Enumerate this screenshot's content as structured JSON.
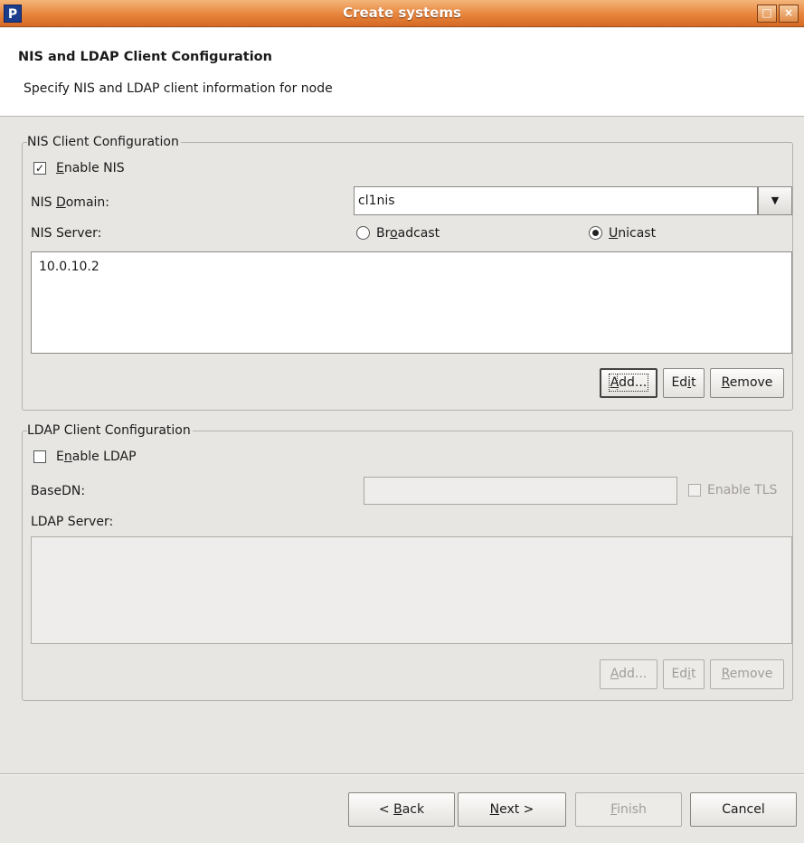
{
  "window": {
    "icon_letter": "P",
    "title": "Create systems",
    "maximize_glyph": "□",
    "close_glyph": "×"
  },
  "header": {
    "title": "NIS and LDAP Client Configuration",
    "description": "Specify NIS and LDAP client information for node"
  },
  "nis": {
    "group_label": "NIS Client Configuration",
    "enable_label_pre": "",
    "enable_label_mnemonic": "E",
    "enable_label_post": "nable NIS",
    "enable_checked": true,
    "domain_label_pre": "NIS ",
    "domain_label_mnemonic": "D",
    "domain_label_post": "omain:",
    "domain_value": "cl1nis",
    "server_label": "NIS Server:",
    "broadcast_pre": "Br",
    "broadcast_mnemonic": "o",
    "broadcast_post": "adcast",
    "unicast_pre": "",
    "unicast_mnemonic": "U",
    "unicast_post": "nicast",
    "selected_mode": "Unicast",
    "servers": [
      "10.0.10.2"
    ],
    "add_mnemonic": "A",
    "add_post": "dd...",
    "edit_pre": "Ed",
    "edit_mnemonic": "i",
    "edit_post": "t",
    "remove_mnemonic": "R",
    "remove_post": "emove"
  },
  "ldap": {
    "group_label": "LDAP Client Configuration",
    "enable_pre": "E",
    "enable_mnemonic": "n",
    "enable_post": "able LDAP",
    "enable_checked": false,
    "basedn_label": "BaseDN:",
    "basedn_value": "",
    "tls_label": "Enable TLS",
    "server_label": "LDAP Server:",
    "add_mnemonic": "A",
    "add_post": "dd...",
    "edit_pre": "Ed",
    "edit_mnemonic": "i",
    "edit_post": "t",
    "remove_mnemonic": "R",
    "remove_post": "emove"
  },
  "footer": {
    "back_pre": "< ",
    "back_mnemonic": "B",
    "back_post": "ack",
    "next_mnemonic": "N",
    "next_post": "ext >",
    "finish_mnemonic": "F",
    "finish_post": "inish",
    "cancel_label": "Cancel"
  },
  "colors": {
    "titlebar": "#e8843c",
    "window_bg": "#e8e6e3",
    "disabled_text": "#a19d98"
  }
}
